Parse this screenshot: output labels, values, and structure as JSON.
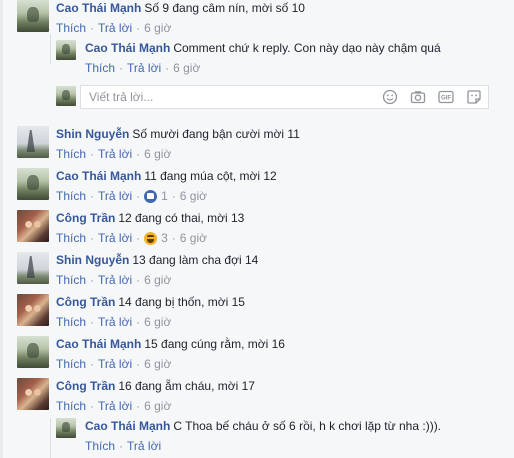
{
  "actions": {
    "like": "Thích",
    "reply": "Trả lời",
    "sep": "·"
  },
  "reply_box": {
    "placeholder": "Viết trả lời..."
  },
  "comments": [
    {
      "name": "Cao Thái Mạnh",
      "text": "Số 9 đang câm nín, mời số 10",
      "time": "6 giờ"
    },
    {
      "name": "Cao Thái Mạnh",
      "text": "Comment chứ k reply. Con này dạo này chậm quá",
      "time": "6 giờ"
    },
    {
      "name": "Shin Nguyễn",
      "text": "Số mười đang bận cười mời 11",
      "time": "6 giờ"
    },
    {
      "name": "Cao Thái Mạnh",
      "text": "11 đang múa cột, mời 12",
      "time": "6 giờ",
      "reaction": {
        "icon": "like-icon",
        "count": "1"
      }
    },
    {
      "name": "Công Trần",
      "text": "12 đang có thai, mời 13",
      "time": "6 giờ",
      "reaction": {
        "icon": "haha-icon",
        "count": "3"
      }
    },
    {
      "name": "Shin Nguyễn",
      "text": "13 đang làm cha đợi 14",
      "time": "6 giờ"
    },
    {
      "name": "Công Trần",
      "text": "14 đang bị thốn, mời 15",
      "time": "6 giờ"
    },
    {
      "name": "Cao Thái Mạnh",
      "text": "15 đang cúng rằm, mời 16",
      "time": "6 giờ"
    },
    {
      "name": "Công Trần",
      "text": "16 đang ẵm cháu, mời 17",
      "time": "6 giờ"
    },
    {
      "name": "Cao Thái Mạnh",
      "text": "C Thoa bế cháu ở số 6 rồi, h k chơi lặp từ nha :))).",
      "time": ""
    }
  ]
}
